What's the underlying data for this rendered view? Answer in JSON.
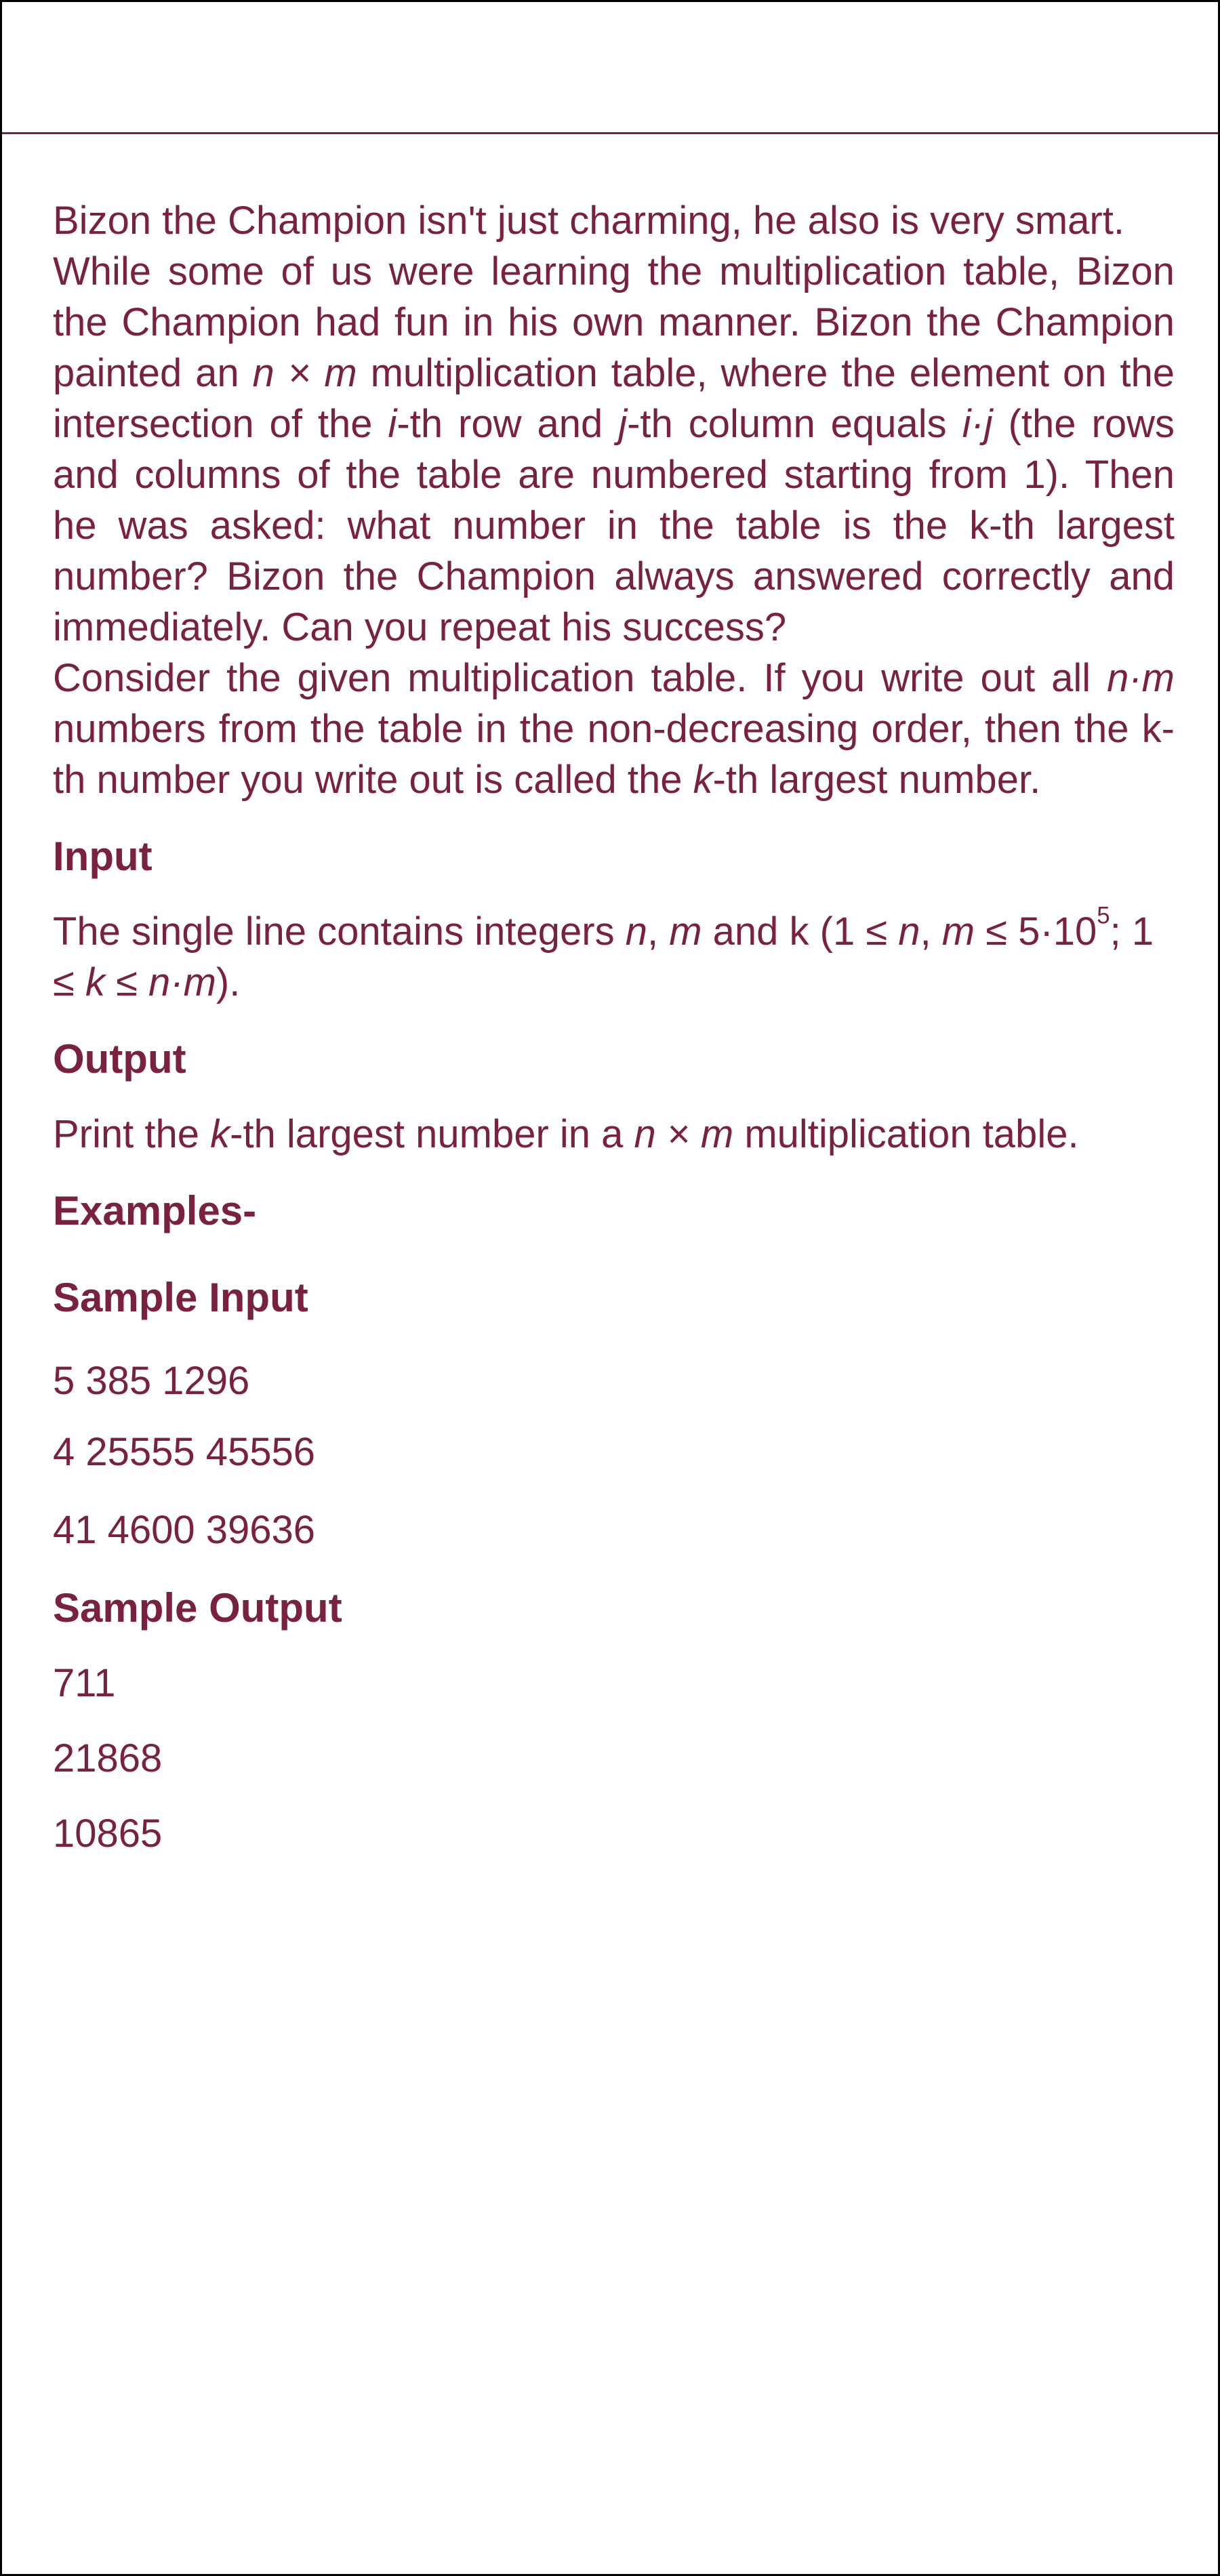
{
  "statement": {
    "p1_a": "Bizon the Champion isn't just charming, he also is very smart.",
    "p2_a": "While some of us were learning the multiplication table, Bizon the Champion had fun in his own manner. Bizon the Champion painted an ",
    "p2_nm": "n × m",
    "p2_b": " multiplication table, where the element on the intersection of the ",
    "p2_i": "i",
    "p2_c": "-th row and ",
    "p2_j": "j",
    "p2_d": "-th column equals ",
    "p2_ij": "i·j",
    "p2_e": " (the rows and columns of the table are numbered starting from 1). Then he was asked: what number in the table is the k-th largest number? Bizon the Champion always answered correctly and immediately. Can you repeat his success?",
    "p3_a": "Consider the given multiplication table. If you write out all ",
    "p3_nm": "n·m",
    "p3_b": " numbers from the table in the non-decreasing order, then the k-th number you write out is called the ",
    "p3_k": "k",
    "p3_c": "-th largest number."
  },
  "input": {
    "heading": "Input",
    "t1": "The single line contains integers ",
    "n": "n",
    "comma": ", ",
    "m": "m",
    "t2": " and k (1 ≤ ",
    "n2": "n",
    "comma2": ", ",
    "m2": "m",
    "t3": " ≤ 5·10",
    "exp": "5",
    "t4": "; 1 ≤ ",
    "k": "k",
    "t5": " ≤ ",
    "nm": "n·m",
    "t6": ")."
  },
  "output": {
    "heading": "Output",
    "t1": "Print the ",
    "k": "k",
    "t2": "-th largest number in a ",
    "nm": "n × m",
    "t3": " multiplication table."
  },
  "examples": {
    "heading": "Examples-",
    "sample_input_heading": "Sample Input",
    "inputs": [
      "5 385 1296",
      "4 25555 45556",
      "41 4600 39636"
    ],
    "sample_output_heading": "Sample Output",
    "outputs": [
      "711",
      "21868",
      "10865"
    ]
  }
}
